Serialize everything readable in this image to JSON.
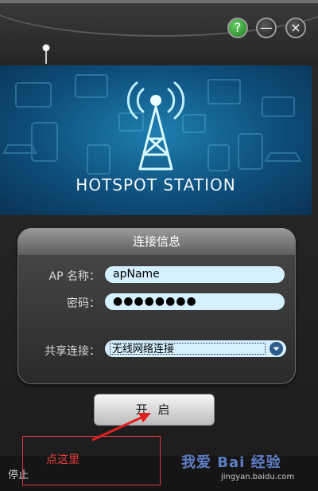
{
  "window": {
    "help_label": "?",
    "minimize_label": "—",
    "close_label": "×"
  },
  "banner": {
    "title": "HOTSPOT STATION"
  },
  "panel": {
    "title": "连接信息",
    "ap_name_label": "AP 名称：",
    "ap_name_value": "apName",
    "password_label": "密码：",
    "password_value": "●●●●●●●●",
    "share_label": "共享连接：",
    "share_value": "无线网络连接"
  },
  "start_button": {
    "label": "开 启"
  },
  "status": {
    "stop_label": "停止"
  },
  "annotation": {
    "text": "点这里",
    "color": "#e83c3c"
  },
  "watermark": {
    "text": "我爱 Bai 经验",
    "url": "jingyan.baidu.com"
  },
  "colors": {
    "field_bg": "#d4efff",
    "banner_blue": "#1e7fb0",
    "help_green": "#2fa02f"
  }
}
